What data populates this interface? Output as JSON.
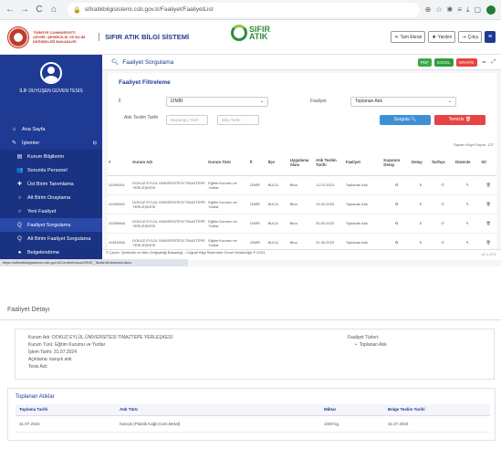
{
  "browser": {
    "url": "sifiratikbilgisistemi.csb.gov.tr/Faaliyet/FaaliyetList",
    "nav": [
      "←",
      "→",
      "C",
      "⌂"
    ],
    "icons": [
      "⊕",
      "☆",
      "✱",
      "≡",
      "⤓",
      "▢"
    ]
  },
  "header": {
    "ministry_text": "TÜRKİYE CUMHURİYETİ ÇEVRE, ŞEHİRCİLİK VE İKLİM DEĞİŞİKLİĞİ BAKANLIĞI",
    "system_title": "SIFIR ATIK BİLGİ SİSTEMİ",
    "logo_text_1": "SIFIR",
    "logo_text_2": "ATIK",
    "buttons": [
      {
        "icon": "✕",
        "label": "Tam Ekran"
      },
      {
        "icon": "✚",
        "label": "Yardım"
      },
      {
        "icon": "⇥",
        "label": "Çıkış"
      }
    ],
    "menu_icon": "≡"
  },
  "sidebar": {
    "user_name": "İLİF DUYUŞEN GÜVEN TESİS",
    "items": [
      {
        "icon": "⌂",
        "label": "Ana Sayfa",
        "kind": "top"
      },
      {
        "icon": "✎",
        "label": "İşlemler",
        "kind": "top",
        "arrow": "⊟"
      },
      {
        "icon": "▤",
        "label": "Kurum Bilgilerim",
        "kind": "sub"
      },
      {
        "icon": "👥",
        "label": "Sorumlu Personel",
        "kind": "sub"
      },
      {
        "icon": "✚",
        "label": "Üst Birim Tanımlama",
        "kind": "sub"
      },
      {
        "icon": "○",
        "label": "Alt Birim Onaylama",
        "kind": "sub"
      },
      {
        "icon": "○",
        "label": "Yeni Faaliyet",
        "kind": "sub"
      },
      {
        "icon": "Q",
        "label": "Faaliyet Sorgulama",
        "kind": "sub"
      },
      {
        "icon": "Q",
        "label": "Alt Birim Faaliyet Sorgulama",
        "kind": "sub"
      },
      {
        "icon": "●",
        "label": "Belgelendirme",
        "kind": "sub"
      }
    ],
    "status_link": "https://sifiratikbilgisistemi.csb.gov.tr/Content/docs/SIFAT_TanitimDokumani.docx"
  },
  "panel": {
    "title": "Faaliyet Sorgulama",
    "tools": {
      "pdf": "PDF",
      "excel": "EXCEL",
      "grafik": "GRAFİK"
    },
    "filter_title": "Faaliyet Filtreleme",
    "il_label": "İl",
    "il_value": "İZMİR",
    "faaliyet_label": "Faaliyet",
    "faaliyet_value": "Toplanan Atık",
    "atik_teslim_label": "Atık Teslim Tarihi",
    "baslangic_placeholder": "Başlangıç Tarih",
    "bitis_placeholder": "Bitiş Tarihi",
    "sorgula": "Sorgula",
    "temizle": "Temizle",
    "total_count": "Toplam Kayıt Sayısı: 137"
  },
  "table": {
    "headers": [
      "#",
      "Kurum Adı",
      "Kurum Türü",
      "İl",
      "İlçe",
      "Uygulama Alanı",
      "Atık Teslim Tarihi",
      "Faaliyet",
      "Kazanım Detay",
      "Detay",
      "Tarihçe",
      "Düzenle",
      "Sil"
    ],
    "rows": [
      [
        "41599261",
        "DOKUZ EYLÜL ÜNİVERSİTESİ TINAZTEPE YERLEŞKESİ",
        "Eğitim Kurumu ve Yurtlar",
        "İZMİR",
        "BUCA",
        "Bina",
        "11.03.2023",
        "Toplanan Atık"
      ],
      [
        "41599262",
        "DOKUZ EYLÜL ÜNİVERSİTESİ TINAZTEPE YERLEŞKESİ",
        "Eğitim Kurumu ve Yurtlar",
        "İZMİR",
        "BUCA",
        "Bina",
        "15.03.2023",
        "Toplanan Atık"
      ],
      [
        "41599666",
        "DOKUZ EYLÜL ÜNİVERSİTESİ TINAZTEPE YERLEŞKESİ",
        "Eğitim Kurumu ve Yurtlar",
        "İZMİR",
        "BUCA",
        "Bina",
        "30.03.2023",
        "Toplanan Atık"
      ],
      [
        "41510066",
        "DOKUZ EYLÜL ÜNİVERSİTESİ TINAZTEPE YERLEŞKESİ",
        "Eğitim Kurumu ve Yurtlar",
        "İZMİR",
        "BUCA",
        "Bina",
        "31.05.2023",
        "Toplanan Atık"
      ]
    ],
    "action_icons": {
      "kazanim": "♻",
      "detay": "ℹ",
      "tarihce": "↺",
      "duzenle": "✎",
      "sil": "🗑"
    }
  },
  "footer": {
    "text": "© Çevre, Şehircilik ve İklim Değişikliği Bakanlığı - Coğrafi Bilgi Sistemleri Genel Müdürlüğü © 2023",
    "version": "v2.1.273"
  },
  "detail": {
    "title": "Faaliyet Detayı",
    "kurum_adi": "Kurum Adı: DOKUZ EYLÜL ÜNİVERSİTESİ TINAZTEPE YERLEŞKESİ",
    "kurum_turu": "Kurum Türü: Eğitim Kurumu ve Yurtlar",
    "islem_tarihi": "İşlem Tarihi: 31.07.2024",
    "aciklama": "Açıklama: karışık atık",
    "tesis_adi": "Tesis Adı:",
    "faaliyet_turleri_label": "Faaliyet Türleri:",
    "faaliyet_turu": "Toplanan Atık",
    "collected_title": "Toplanan Atıklar",
    "collected_headers": [
      "Toplama Tarihi",
      "Atık Türü",
      "Miktar",
      "Belge Teslim Tarihi"
    ],
    "collected_row": [
      "31.07.2024",
      "Karışık (Plastik Kağıt,Cam,Metal)",
      "1000 kg",
      "31.07.2024"
    ]
  }
}
